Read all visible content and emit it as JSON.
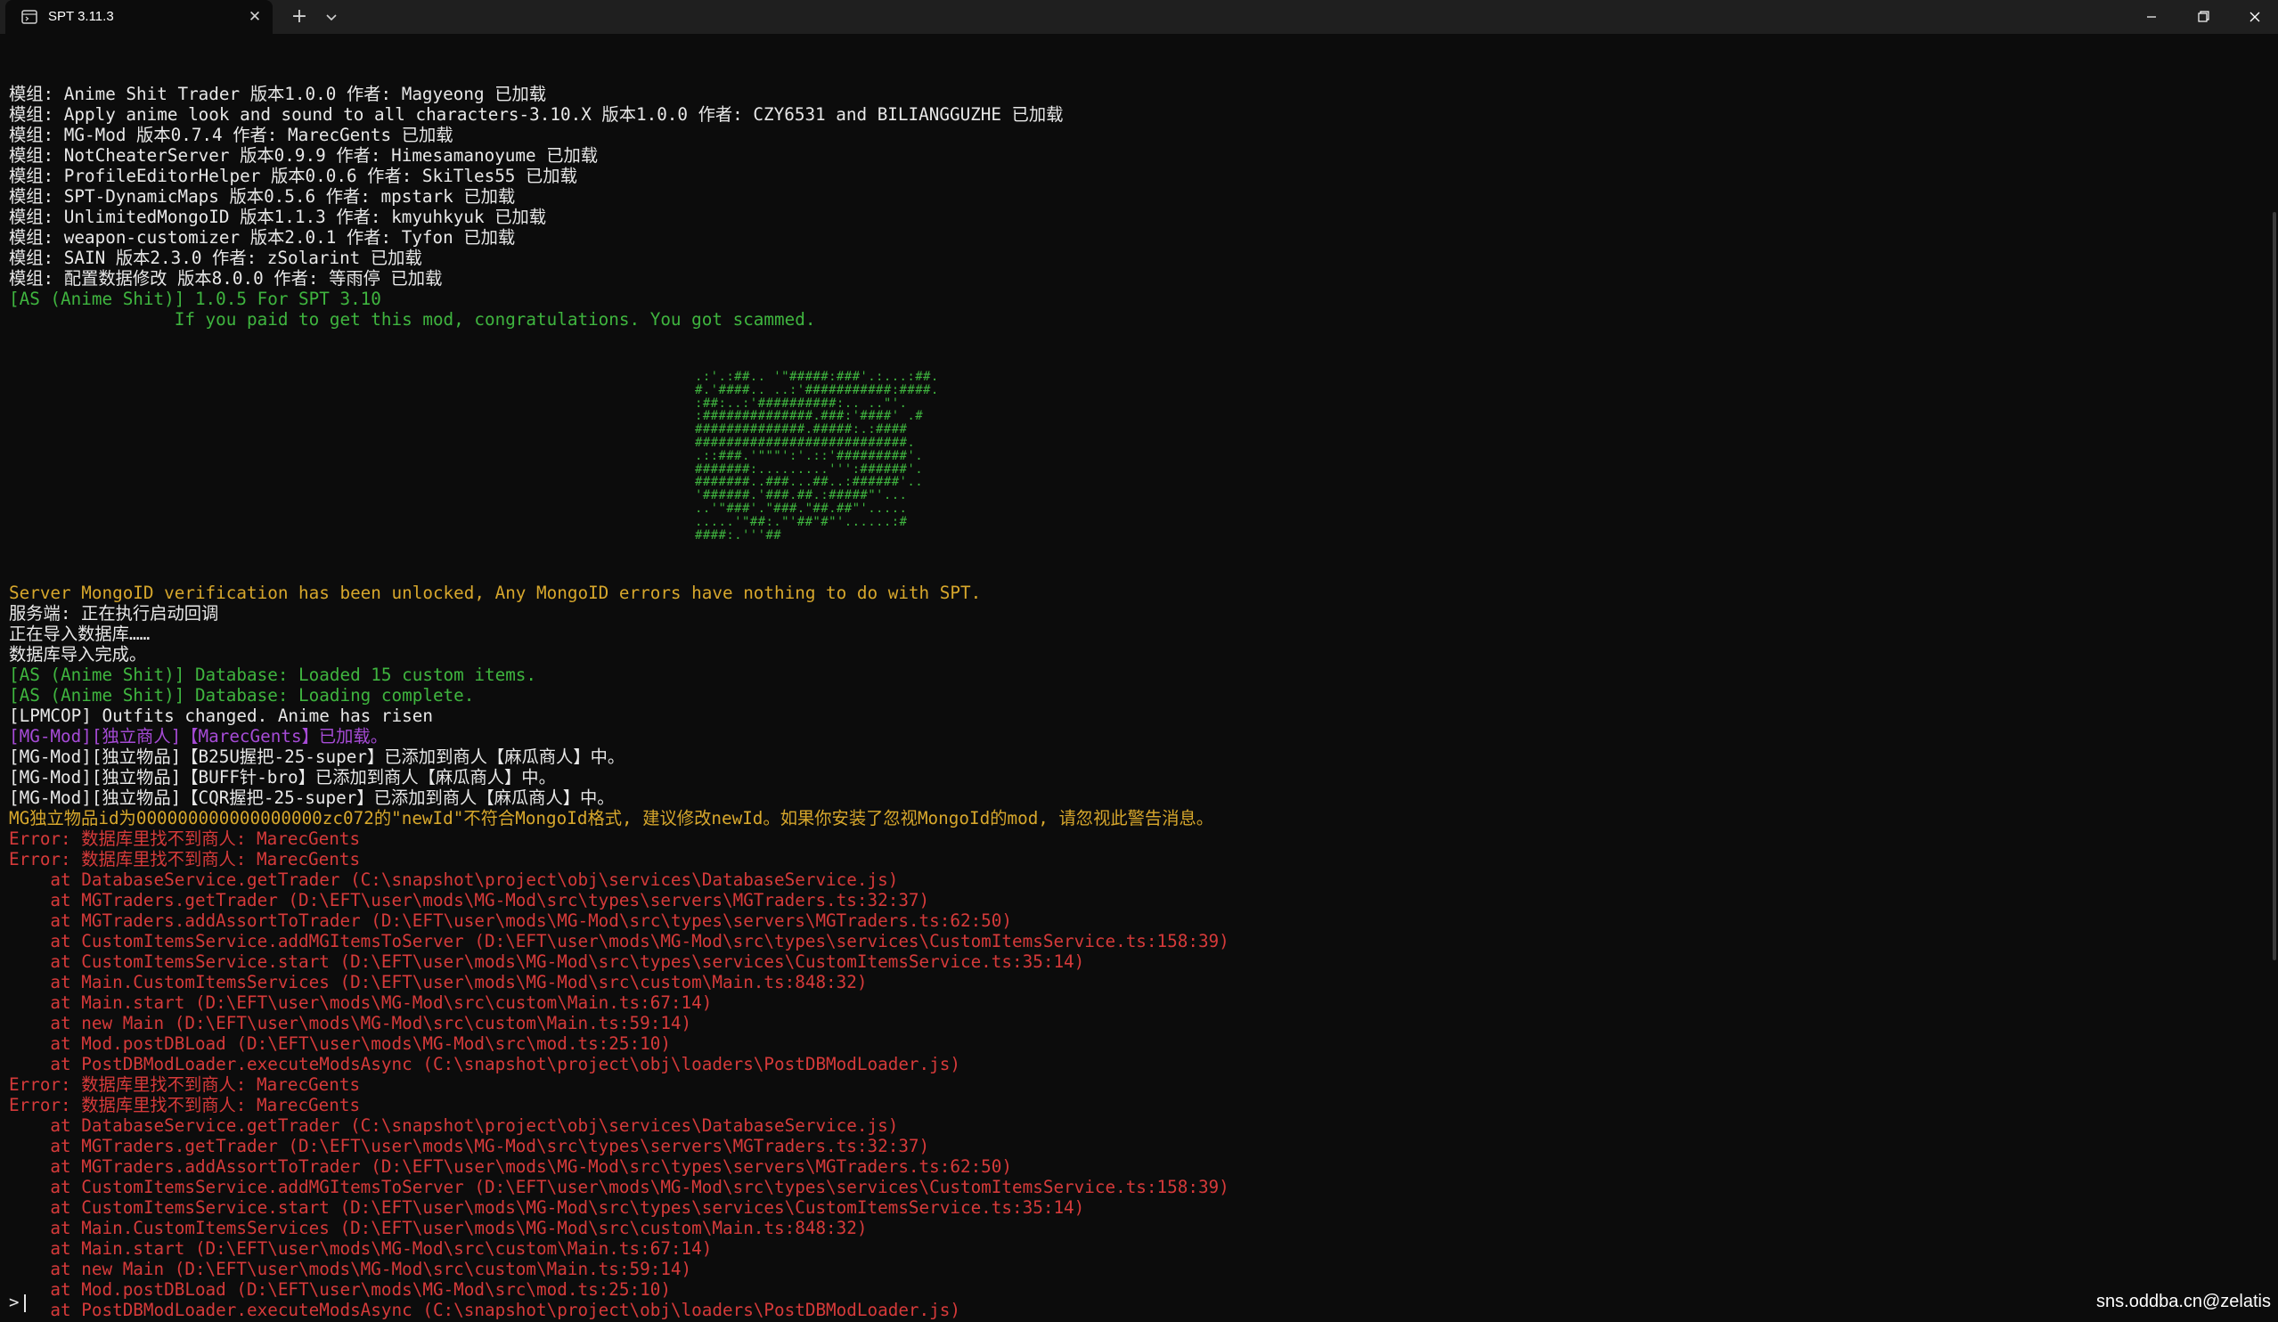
{
  "window": {
    "tab_title": "SPT 3.11.3",
    "icons": {
      "tab": "terminal-icon",
      "close_tab": "close-icon",
      "new_tab": "plus-icon",
      "dropdown": "chevron-down-icon",
      "minimize": "minimize-icon",
      "restore": "restore-icon",
      "close_window": "close-icon"
    }
  },
  "terminal": {
    "lines_top": [
      {
        "text": "模组: Anime Shit Trader 版本1.0.0 作者: Magyeong 已加载",
        "color": "white"
      },
      {
        "text": "模组: Apply anime look and sound to all characters-3.10.X 版本1.0.0 作者: CZY6531 and BILIANGGUZHE 已加载",
        "color": "white"
      },
      {
        "text": "模组: MG-Mod 版本0.7.4 作者: MarecGents 已加载",
        "color": "white"
      },
      {
        "text": "模组: NotCheaterServer 版本0.9.9 作者: Himesamanoyume 已加载",
        "color": "white"
      },
      {
        "text": "模组: ProfileEditorHelper 版本0.0.6 作者: SkiTles55 已加载",
        "color": "white"
      },
      {
        "text": "模组: SPT-DynamicMaps 版本0.5.6 作者: mpstark 已加载",
        "color": "white"
      },
      {
        "text": "模组: UnlimitedMongoID 版本1.1.3 作者: kmyuhkyuk 已加载",
        "color": "white"
      },
      {
        "text": "模组: weapon-customizer 版本2.0.1 作者: Tyfon 已加载",
        "color": "white"
      },
      {
        "text": "模组: SAIN 版本2.3.0 作者: zSolarint 已加载",
        "color": "white"
      },
      {
        "text": "模组: 配置数据修改 版本8.0.0 作者: 等雨停 已加载",
        "color": "white"
      },
      {
        "text": "[AS (Anime Shit)] 1.0.5 For SPT 3.10",
        "color": "green"
      },
      {
        "text": "                If you paid to get this mod, congratulations. You got scammed.",
        "color": "green"
      }
    ],
    "ascii_art": [
      ".:'.:##.. '\"#####:###'.:...:##.",
      "#.'####.. ..:'###########:####.",
      ":##:..:'##########:.. ..\"'.",
      ":##############.###:'####' .#",
      "##############.#####:.:####",
      "###########################.",
      ".::###.'\"\"\"':'.::'#########'.",
      "#######:.........''':######'.",
      "#######..###...##..:######'..",
      "'######.'###.##.:#####\"'...",
      "..'\"###'.\"###.\"##.##\"'.....",
      ".....'\"##:.\"'##\"#\"'......:#",
      "####:.'''##"
    ],
    "lines_bottom": [
      {
        "text": "Server MongoID verification has been unlocked, Any MongoID errors have nothing to do with SPT.",
        "color": "yellow"
      },
      {
        "text": "服务端: 正在执行启动回调",
        "color": "white"
      },
      {
        "text": "正在导入数据库……",
        "color": "white"
      },
      {
        "text": "数据库导入完成。",
        "color": "white"
      },
      {
        "text": "[AS (Anime Shit)] Database: Loaded 15 custom items.",
        "color": "green"
      },
      {
        "text": "[AS (Anime Shit)] Database: Loading complete.",
        "color": "green"
      },
      {
        "text": "[LPMCOP] Outfits changed. Anime has risen",
        "color": "white"
      },
      {
        "text": "[MG-Mod][独立商人]【MarecGents】已加载。",
        "color": "magenta"
      },
      {
        "text": "[MG-Mod][独立物品]【B25U握把-25-super】已添加到商人【麻瓜商人】中。",
        "color": "white"
      },
      {
        "text": "[MG-Mod][独立物品]【BUFF针-bro】已添加到商人【麻瓜商人】中。",
        "color": "white"
      },
      {
        "text": "[MG-Mod][独立物品]【CQR握把-25-super】已添加到商人【麻瓜商人】中。",
        "color": "white"
      },
      {
        "text": "MG独立物品id为000000000000000000zc072的\"newId\"不符合MongoId格式, 建议修改newId。如果你安装了忽视MongoId的mod, 请忽视此警告消息。",
        "color": "yellow"
      },
      {
        "text": "Error: 数据库里找不到商人: MarecGents",
        "color": "red"
      },
      {
        "text": "Error: 数据库里找不到商人: MarecGents",
        "color": "red"
      },
      {
        "text": "    at DatabaseService.getTrader (C:\\snapshot\\project\\obj\\services\\DatabaseService.js)",
        "color": "red"
      },
      {
        "text": "    at MGTraders.getTrader (D:\\EFT\\user\\mods\\MG-Mod\\src\\types\\servers\\MGTraders.ts:32:37)",
        "color": "red"
      },
      {
        "text": "    at MGTraders.addAssortToTrader (D:\\EFT\\user\\mods\\MG-Mod\\src\\types\\servers\\MGTraders.ts:62:50)",
        "color": "red"
      },
      {
        "text": "    at CustomItemsService.addMGItemsToServer (D:\\EFT\\user\\mods\\MG-Mod\\src\\types\\services\\CustomItemsService.ts:158:39)",
        "color": "red"
      },
      {
        "text": "    at CustomItemsService.start (D:\\EFT\\user\\mods\\MG-Mod\\src\\types\\services\\CustomItemsService.ts:35:14)",
        "color": "red"
      },
      {
        "text": "    at Main.CustomItemsServices (D:\\EFT\\user\\mods\\MG-Mod\\src\\custom\\Main.ts:848:32)",
        "color": "red"
      },
      {
        "text": "    at Main.start (D:\\EFT\\user\\mods\\MG-Mod\\src\\custom\\Main.ts:67:14)",
        "color": "red"
      },
      {
        "text": "    at new Main (D:\\EFT\\user\\mods\\MG-Mod\\src\\custom\\Main.ts:59:14)",
        "color": "red"
      },
      {
        "text": "    at Mod.postDBLoad (D:\\EFT\\user\\mods\\MG-Mod\\src\\mod.ts:25:10)",
        "color": "red"
      },
      {
        "text": "    at PostDBModLoader.executeModsAsync (C:\\snapshot\\project\\obj\\loaders\\PostDBModLoader.js)",
        "color": "red"
      },
      {
        "text": "Error: 数据库里找不到商人: MarecGents",
        "color": "red"
      },
      {
        "text": "Error: 数据库里找不到商人: MarecGents",
        "color": "red"
      },
      {
        "text": "    at DatabaseService.getTrader (C:\\snapshot\\project\\obj\\services\\DatabaseService.js)",
        "color": "red"
      },
      {
        "text": "    at MGTraders.getTrader (D:\\EFT\\user\\mods\\MG-Mod\\src\\types\\servers\\MGTraders.ts:32:37)",
        "color": "red"
      },
      {
        "text": "    at MGTraders.addAssortToTrader (D:\\EFT\\user\\mods\\MG-Mod\\src\\types\\servers\\MGTraders.ts:62:50)",
        "color": "red"
      },
      {
        "text": "    at CustomItemsService.addMGItemsToServer (D:\\EFT\\user\\mods\\MG-Mod\\src\\types\\services\\CustomItemsService.ts:158:39)",
        "color": "red"
      },
      {
        "text": "    at CustomItemsService.start (D:\\EFT\\user\\mods\\MG-Mod\\src\\types\\services\\CustomItemsService.ts:35:14)",
        "color": "red"
      },
      {
        "text": "    at Main.CustomItemsServices (D:\\EFT\\user\\mods\\MG-Mod\\src\\custom\\Main.ts:848:32)",
        "color": "red"
      },
      {
        "text": "    at Main.start (D:\\EFT\\user\\mods\\MG-Mod\\src\\custom\\Main.ts:67:14)",
        "color": "red"
      },
      {
        "text": "    at new Main (D:\\EFT\\user\\mods\\MG-Mod\\src\\custom\\Main.ts:59:14)",
        "color": "red"
      },
      {
        "text": "    at Mod.postDBLoad (D:\\EFT\\user\\mods\\MG-Mod\\src\\mod.ts:25:10)",
        "color": "red"
      },
      {
        "text": "    at PostDBModLoader.executeModsAsync (C:\\snapshot\\project\\obj\\loaders\\PostDBModLoader.js)",
        "color": "red"
      }
    ],
    "prompt": ">",
    "colors": {
      "white": "#e8e8e8",
      "green": "#3fb53f",
      "yellow": "#d7a72c",
      "red": "#d63a3a",
      "magenta": "#a64bd6"
    }
  },
  "watermark": "sns.oddba.cn@zelatis"
}
